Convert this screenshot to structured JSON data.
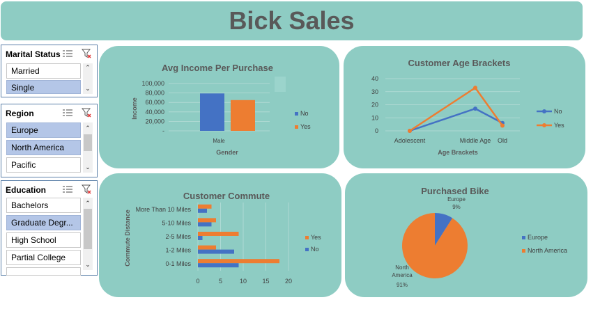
{
  "title": "Bick Sales",
  "slicers": {
    "marital": {
      "title": "Marital Status",
      "items": [
        {
          "label": "Married",
          "selected": false
        },
        {
          "label": "Single",
          "selected": true
        }
      ]
    },
    "region": {
      "title": "Region",
      "items": [
        {
          "label": "Europe",
          "selected": true
        },
        {
          "label": "North America",
          "selected": true
        },
        {
          "label": "Pacific",
          "selected": false
        }
      ]
    },
    "education": {
      "title": "Education",
      "items": [
        {
          "label": "Bachelors",
          "selected": false
        },
        {
          "label": "Graduate Degr...",
          "selected": true
        },
        {
          "label": "High School",
          "selected": false
        },
        {
          "label": "Partial College",
          "selected": false
        }
      ]
    }
  },
  "colors": {
    "no": "#4472C4",
    "yes": "#ED7D31",
    "panel": "#8ECCC3"
  },
  "chart_data": [
    {
      "type": "bar",
      "title": "Avg Income Per Purchase",
      "xlabel": "Gender",
      "ylabel": "Income",
      "categories": [
        "Male"
      ],
      "series": [
        {
          "name": "No",
          "values": [
            79000
          ]
        },
        {
          "name": "Yes",
          "values": [
            65000
          ]
        }
      ],
      "ylim": [
        0,
        100000
      ],
      "yticks": [
        "100,000",
        "80,000",
        "60,000",
        "40,000",
        "20,000",
        "-"
      ]
    },
    {
      "type": "line",
      "title": "Customer Age Brackets",
      "xlabel": "Age Brackets",
      "ylabel": "",
      "categories": [
        "Adolescent",
        "Middle Age",
        "Old"
      ],
      "series": [
        {
          "name": "No",
          "values": [
            0,
            17,
            6
          ]
        },
        {
          "name": "Yes",
          "values": [
            0,
            33,
            4
          ]
        }
      ],
      "ylim": [
        0,
        40
      ],
      "yticks": [
        "40",
        "30",
        "20",
        "10",
        "0"
      ]
    },
    {
      "type": "bar",
      "orientation": "horizontal",
      "title": "Customer Commute",
      "ylabel": "Commute Distance",
      "xlabel": "",
      "categories": [
        "More Than 10 Miles",
        "5-10 Miles",
        "2-5 Miles",
        "1-2 Miles",
        "0-1 Miles"
      ],
      "series": [
        {
          "name": "No",
          "values": [
            2,
            3,
            1,
            8,
            9
          ]
        },
        {
          "name": "Yes",
          "values": [
            3,
            4,
            9,
            4,
            18
          ]
        }
      ],
      "xlim": [
        0,
        20
      ],
      "xticks": [
        "0",
        "5",
        "10",
        "15",
        "20"
      ]
    },
    {
      "type": "pie",
      "title": "Purchased Bike",
      "slices": [
        {
          "name": "Europe",
          "value": 9,
          "label": "9%"
        },
        {
          "name": "North America",
          "value": 91,
          "label": "91%"
        }
      ]
    }
  ]
}
